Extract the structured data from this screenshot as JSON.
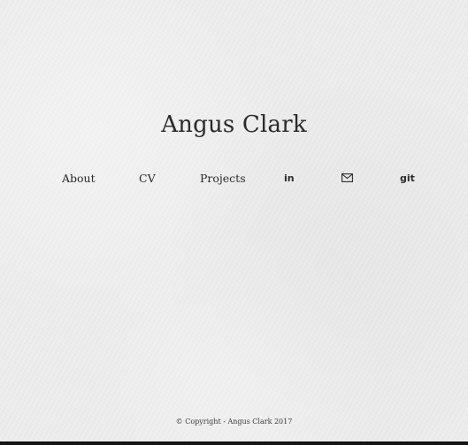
{
  "header": {
    "title": "Angus Clark"
  },
  "nav": {
    "about": "About",
    "cv": "CV",
    "projects": "Projects",
    "linkedin": "in",
    "email_icon": "mail-icon",
    "git": "git"
  },
  "footer": {
    "copyright": "© Copyright - Angus Clark 2017"
  },
  "colors": {
    "background": "#ebebeb",
    "text": "#2a2a2a"
  }
}
